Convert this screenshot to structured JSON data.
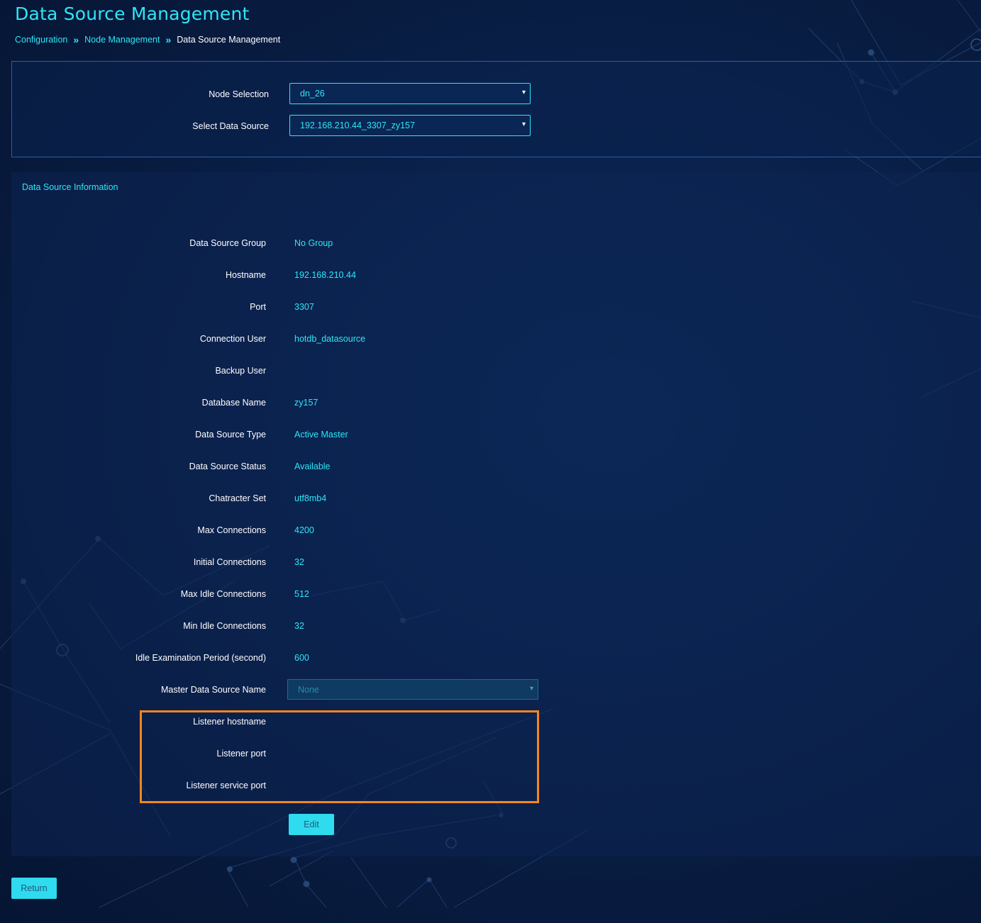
{
  "page": {
    "title": "Data Source Management",
    "breadcrumb": {
      "items": [
        {
          "label": "Configuration"
        },
        {
          "label": "Node Management"
        },
        {
          "label": "Data Source Management"
        }
      ],
      "separator": "»"
    }
  },
  "selection": {
    "node_label": "Node Selection",
    "node_value": "dn_26",
    "source_label": "Select Data Source",
    "source_value": "192.168.210.44_3307_zy157"
  },
  "info": {
    "title": "Data Source Information",
    "rows": [
      {
        "label": "Data Source Group",
        "value": "No Group"
      },
      {
        "label": "Hostname",
        "value": "192.168.210.44"
      },
      {
        "label": "Port",
        "value": "3307"
      },
      {
        "label": "Connection User",
        "value": "hotdb_datasource"
      },
      {
        "label": "Backup User",
        "value": ""
      },
      {
        "label": "Database Name",
        "value": "zy157"
      },
      {
        "label": "Data Source Type",
        "value": "Active Master"
      },
      {
        "label": "Data Source Status",
        "value": "Available"
      },
      {
        "label": "Chatracter Set",
        "value": "utf8mb4"
      },
      {
        "label": "Max Connections",
        "value": "4200"
      },
      {
        "label": "Initial Connections",
        "value": "32"
      },
      {
        "label": "Max Idle Connections",
        "value": "512"
      },
      {
        "label": "Min Idle Connections",
        "value": "32"
      },
      {
        "label": "Idle Examination Period (second)",
        "value": "600"
      }
    ],
    "master": {
      "label": "Master Data Source Name",
      "value": "None"
    },
    "listener_rows": [
      {
        "label": "Listener hostname",
        "value": ""
      },
      {
        "label": "Listener port",
        "value": ""
      },
      {
        "label": "Listener service port",
        "value": ""
      }
    ]
  },
  "buttons": {
    "edit": "Edit",
    "return": "Return"
  },
  "icons": {
    "dropdown": "▾"
  },
  "colors": {
    "accent": "#2ee6f5",
    "highlight": "#f5861f",
    "button": "#2edbef",
    "background": "#081b3f"
  }
}
